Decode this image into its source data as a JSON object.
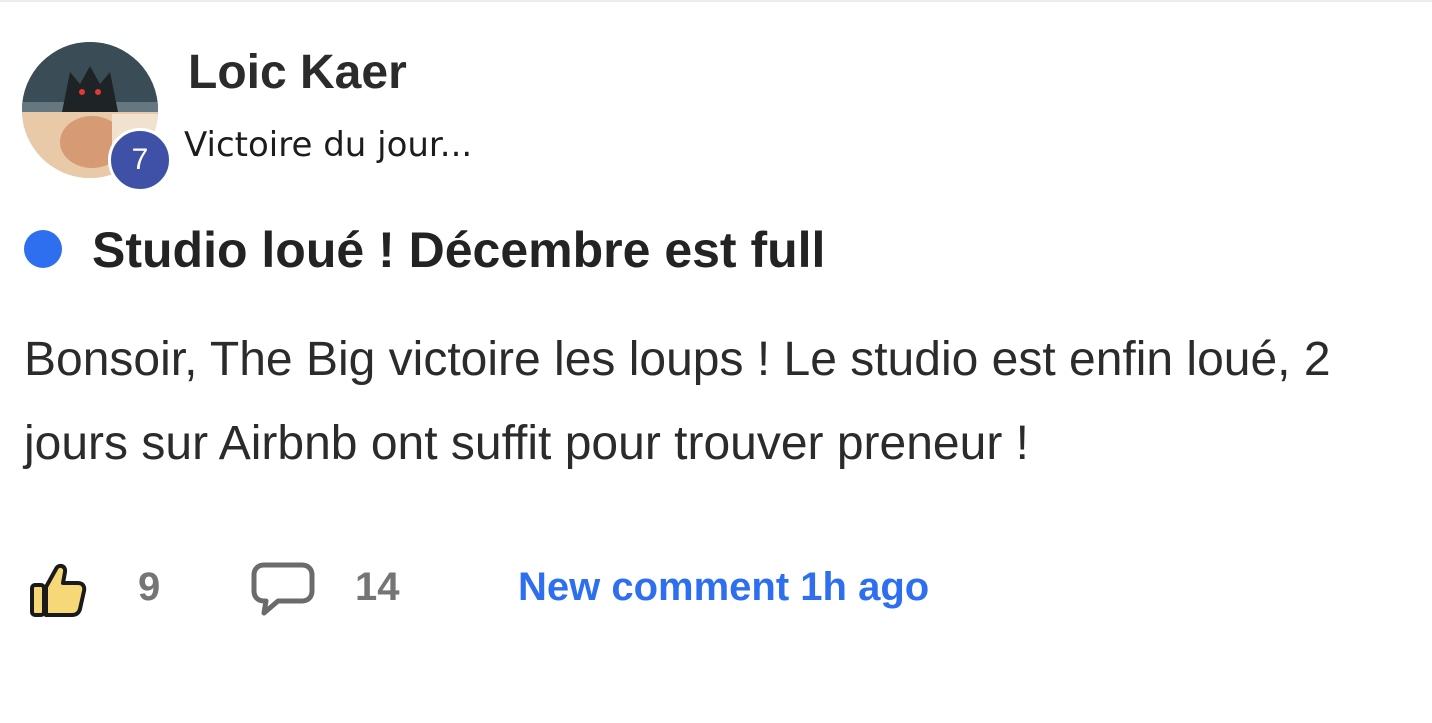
{
  "post": {
    "author": "Loic Kaer",
    "author_level": "7",
    "subtitle": "Victoire du jour...",
    "title": "Studio loué ! Décembre est full",
    "body": "Bonsoir, The Big victoire les loups ! Le studio est enfin loué, 2 jours sur Airbnb ont suffit pour trouver preneur !",
    "unread_indicator_color": "#2e6ff0"
  },
  "footer": {
    "like_icon": "thumbs-up-icon",
    "like_count": "9",
    "comment_icon": "comment-bubble-icon",
    "comment_count": "14",
    "new_comment_label": "New comment 1h ago",
    "link_color": "#2e6ff0"
  }
}
